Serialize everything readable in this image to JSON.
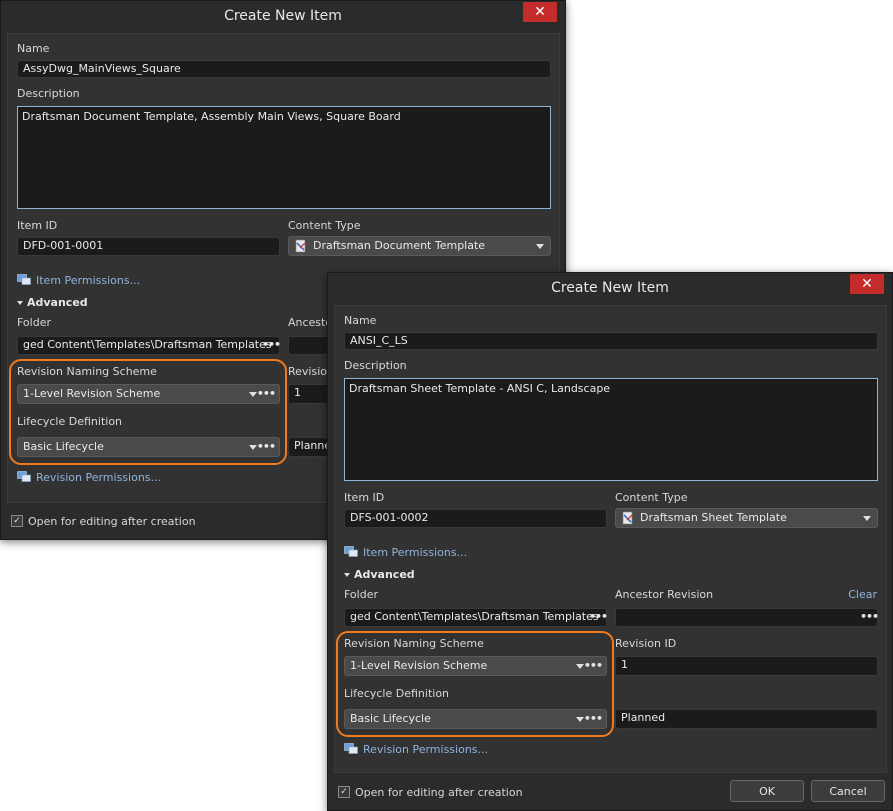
{
  "colors": {
    "dialog_bg": "#2b2b2b",
    "panel_bg": "#323232",
    "field_bg": "#1b1b1b",
    "close_red": "#c42b2b",
    "link_blue": "#8fb3dd",
    "highlight_orange": "#f07b1e"
  },
  "back_dialog": {
    "title": "Create New Item",
    "close_glyph": "✕",
    "name_label": "Name",
    "name_value": "AssyDwg_MainViews_Square",
    "description_label": "Description",
    "description_value": "Draftsman Document Template, Assembly Main Views, Square Board",
    "item_id_label": "Item ID",
    "item_id_value": "DFD-001-0001",
    "content_type_label": "Content Type",
    "content_type_value": "Draftsman Document Template",
    "item_permissions_link": "Item Permissions...",
    "advanced_label": "Advanced",
    "folder_label": "Folder",
    "folder_value": "ged Content\\Templates\\Draftsman Templates",
    "ancestor_label": "Ancesto",
    "revision_naming_label": "Revision Naming Scheme",
    "revision_naming_value": "1-Level Revision Scheme",
    "revision_id_label": "Revision",
    "revision_id_value": "1",
    "lifecycle_label": "Lifecycle Definition",
    "lifecycle_value": "Basic Lifecycle",
    "lifecycle_state_value": "Planne",
    "revision_permissions_link": "Revision Permissions...",
    "open_for_editing_label": "Open for editing after creation",
    "check_glyph": "✓"
  },
  "front_dialog": {
    "title": "Create New Item",
    "close_glyph": "✕",
    "name_label": "Name",
    "name_value": "ANSI_C_LS",
    "description_label": "Description",
    "description_value": "Draftsman Sheet Template - ANSI C, Landscape",
    "item_id_label": "Item ID",
    "item_id_value": "DFS-001-0002",
    "content_type_label": "Content Type",
    "content_type_value": "Draftsman Sheet Template",
    "item_permissions_link": "Item Permissions...",
    "advanced_label": "Advanced",
    "folder_label": "Folder",
    "folder_value": "ged Content\\Templates\\Draftsman Templates",
    "ancestor_label": "Ancestor Revision",
    "clear_link": "Clear",
    "revision_naming_label": "Revision Naming Scheme",
    "revision_naming_value": "1-Level Revision Scheme",
    "revision_id_label": "Revision ID",
    "revision_id_value": "1",
    "lifecycle_label": "Lifecycle Definition",
    "lifecycle_value": "Basic Lifecycle",
    "lifecycle_state_value": "Planned",
    "revision_permissions_link": "Revision Permissions...",
    "open_for_editing_label": "Open for editing after creation",
    "check_glyph": "✓",
    "ok_label": "OK",
    "cancel_label": "Cancel"
  },
  "icons": {
    "dots": "•••"
  }
}
